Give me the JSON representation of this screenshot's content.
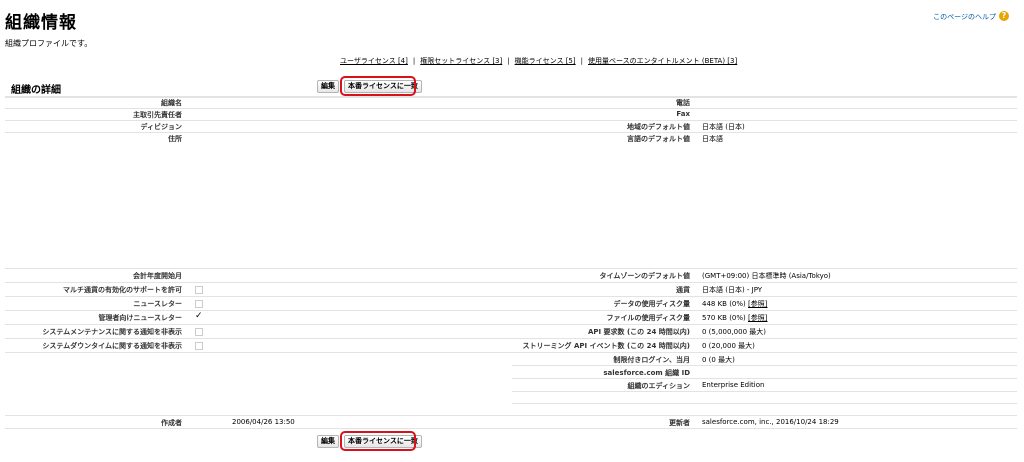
{
  "page": {
    "title": "組織情報",
    "subtitle": "組織プロファイルです。",
    "help_label": "このページのヘルプ",
    "help_icon": "?"
  },
  "license_links": [
    "ユーザライセンス [4]",
    "権限セットライセンス [3]",
    "機能ライセンス [5]",
    "使用量ベースのエンタイトルメント (BETA) [3]"
  ],
  "link_separator": "|",
  "section": {
    "title": "組織の詳細",
    "edit_label": "編集",
    "match_label": "本番ライセンスに一致"
  },
  "left_fields": {
    "org_name": {
      "label": "組織名",
      "value": ""
    },
    "primary_contact": {
      "label": "主取引先責任者",
      "value": ""
    },
    "division": {
      "label": "ディビジョン",
      "value": ""
    },
    "address": {
      "label": "住所",
      "value": ""
    },
    "fiscal_year_start": {
      "label": "会計年度開始月",
      "value": ""
    },
    "multi_currency": {
      "label": "マルチ通貨の有効化のサポートを許可",
      "checked": false
    },
    "newsletter": {
      "label": "ニュースレター",
      "checked": false
    },
    "admin_newsletter": {
      "label": "管理者向けニュースレター",
      "checked": true,
      "mark": "✓"
    },
    "hide_maintenance": {
      "label": "システムメンテナンスに関する通知を非表示",
      "checked": false
    },
    "hide_downtime": {
      "label": "システムダウンタイムに関する通知を非表示",
      "checked": false
    }
  },
  "right_fields": {
    "phone": {
      "label": "電話",
      "value": ""
    },
    "fax": {
      "label": "Fax",
      "value": ""
    },
    "locale": {
      "label": "地域のデフォルト値",
      "value": "日本語 (日本)"
    },
    "language": {
      "label": "言語のデフォルト値",
      "value": "日本語"
    },
    "timezone": {
      "label": "タイムゾーンのデフォルト値",
      "value": "(GMT+09:00) 日本標準時 (Asia/Tokyo)"
    },
    "currency": {
      "label": "通貨",
      "value": "日本語 (日本) - JPY"
    },
    "data_storage": {
      "label": "データの使用ディスク量",
      "value": "448 KB (0%)",
      "link": "[参照]"
    },
    "file_storage": {
      "label": "ファイルの使用ディスク量",
      "value": "570 KB (0%)",
      "link": "[参照]"
    },
    "api_requests": {
      "label": "API 要求数 (この 24 時間以内)",
      "value": "0 (5,000,000 最大)"
    },
    "streaming_events": {
      "label": "ストリーミング API イベント数 (この 24 時間以内)",
      "value": "0 (20,000 最大)"
    },
    "restricted_logins": {
      "label": "制限付きログイン、当月",
      "value": "0 (0 最大)"
    },
    "org_id": {
      "label": "salesforce.com 組織 ID",
      "value": ""
    },
    "edition": {
      "label": "組織のエディション",
      "value": "Enterprise Edition"
    }
  },
  "footer": {
    "created_by": {
      "label": "作成者",
      "value": "2006/04/26 13:50"
    },
    "modified_by": {
      "label": "更新者",
      "value": "salesforce.com, inc., 2016/10/24 18:29"
    }
  },
  "colors": {
    "highlight": "#d8111a",
    "link": "#015ba7",
    "help_icon": "#e8a400"
  }
}
